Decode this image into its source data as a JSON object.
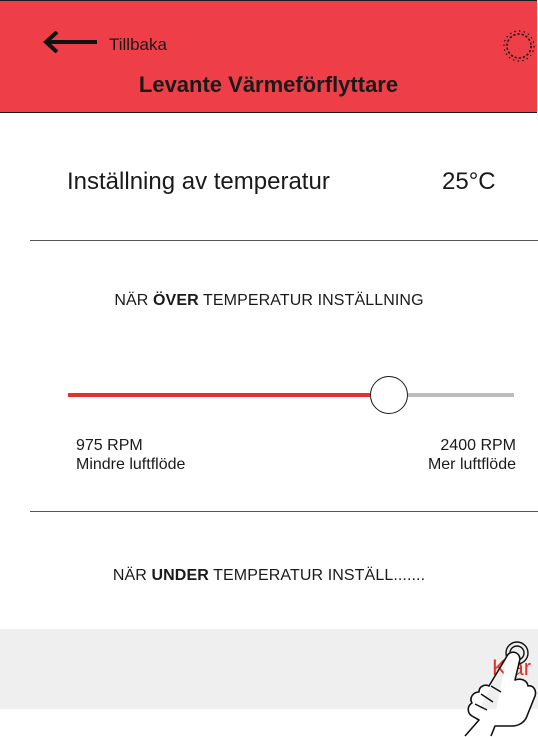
{
  "colors": {
    "header_bg": "#ee3f48",
    "accent": "#e0342b",
    "track_inactive": "#bdbdbd",
    "footer_bg": "#efefef",
    "footer_text": "#e0342b"
  },
  "header": {
    "back_icon": "arrow-left-icon",
    "back_label": "Tillbaka",
    "title": "Levante Värmeförflyttare",
    "settings_icon": "gear-icon"
  },
  "temperature": {
    "label": "Inställning av temperatur",
    "value": "25°C"
  },
  "over_section": {
    "prefix": "NÄR ",
    "emphasis": "ÖVER",
    "suffix": " TEMPERATUR INSTÄLLNING"
  },
  "slider": {
    "value_fraction": 0.72,
    "min_rpm": "975 RPM",
    "min_desc": "Mindre luftflöde",
    "max_rpm": "2400 RPM",
    "max_desc": "Mer luftflöde"
  },
  "under_section": {
    "prefix": "NÄR ",
    "emphasis": "UNDER",
    "suffix": " TEMPERATUR INSTÄLL......."
  },
  "footer": {
    "button_label": "Klar",
    "cursor_icon": "hand-pointer-icon"
  }
}
